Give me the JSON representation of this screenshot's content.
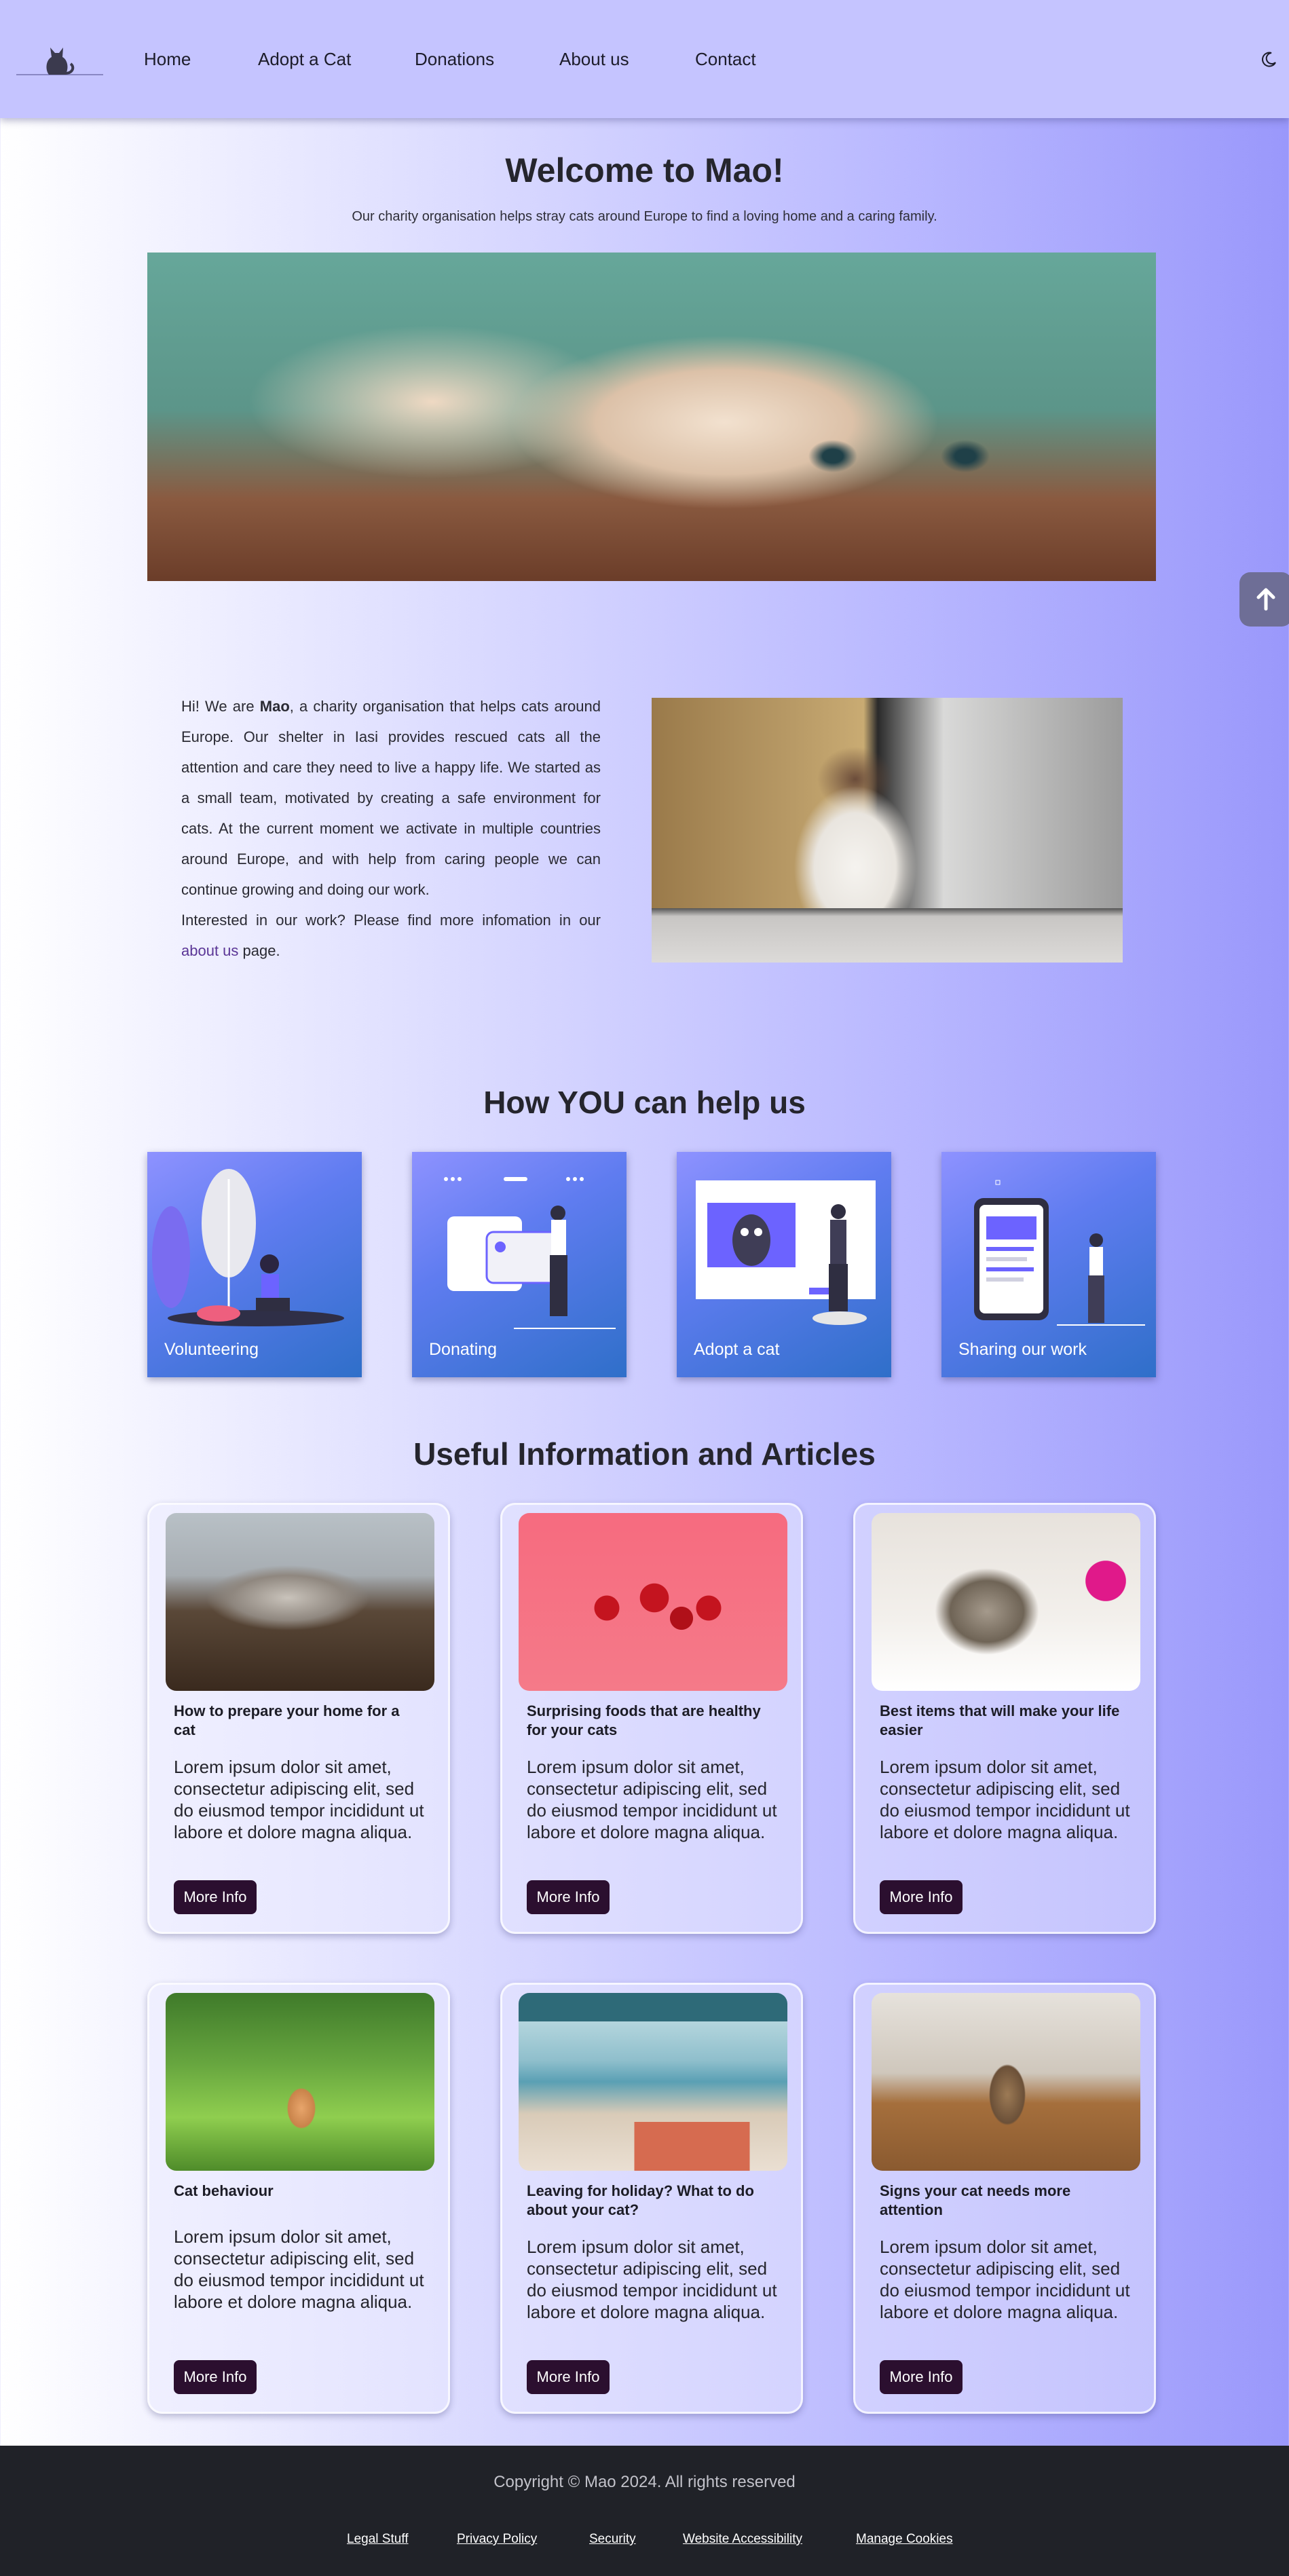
{
  "nav": {
    "links": [
      "Home",
      "Adopt a Cat",
      "Donations",
      "About us",
      "Contact"
    ]
  },
  "hero": {
    "title": "Welcome to Mao!",
    "subtitle": "Our charity organisation helps stray cats around Europe to find a loving home and a caring family."
  },
  "about": {
    "intro": "Hi! We are ",
    "name": "Mao",
    "text": ", a charity organisation that helps cats around Europe. Our shelter in Iasi provides rescued cats all the attention and care they need to live a happy life. We started as a small team, motivated by creating a safe environment for cats. At the current moment we activate in multiple countries around Europe, and with help from caring people we can continue growing and doing our work.",
    "interest": "Interested in our work? Please find more infomation in our ",
    "link": "about us",
    "end": " page."
  },
  "help": {
    "title": "How YOU can help us",
    "cards": [
      "Volunteering",
      "Donating",
      "Adopt a cat",
      "Sharing our work"
    ]
  },
  "articles": {
    "title": "Useful Information and Articles",
    "button": "More Info",
    "body": "Lorem ipsum dolor sit amet, consectetur adipiscing elit, sed do eiusmod tempor incididunt ut labore et dolore magna aliqua.",
    "items": [
      {
        "title": "How to prepare your home for a cat"
      },
      {
        "title": "Surprising foods that are healthy for your cats"
      },
      {
        "title": "Best items that will make your life easier"
      },
      {
        "title": "Cat behaviour"
      },
      {
        "title": "Leaving for holiday? What to do about your cat?"
      },
      {
        "title": "Signs your cat needs more attention"
      }
    ]
  },
  "footer": {
    "copyright": "Copyright © Mao 2024. All rights reserved",
    "links": [
      "Legal Stuff",
      "Privacy Policy",
      "Security",
      "Website Accessibility",
      "Manage Cookies"
    ]
  },
  "colors": {
    "nav_bg": "#c5c4ff",
    "button_bg": "#2b0f2f",
    "footer_bg": "#202228",
    "accent_link": "#5a3596"
  },
  "icons": [
    "cat-logo-icon",
    "moon-icon",
    "arrow-up-icon"
  ]
}
